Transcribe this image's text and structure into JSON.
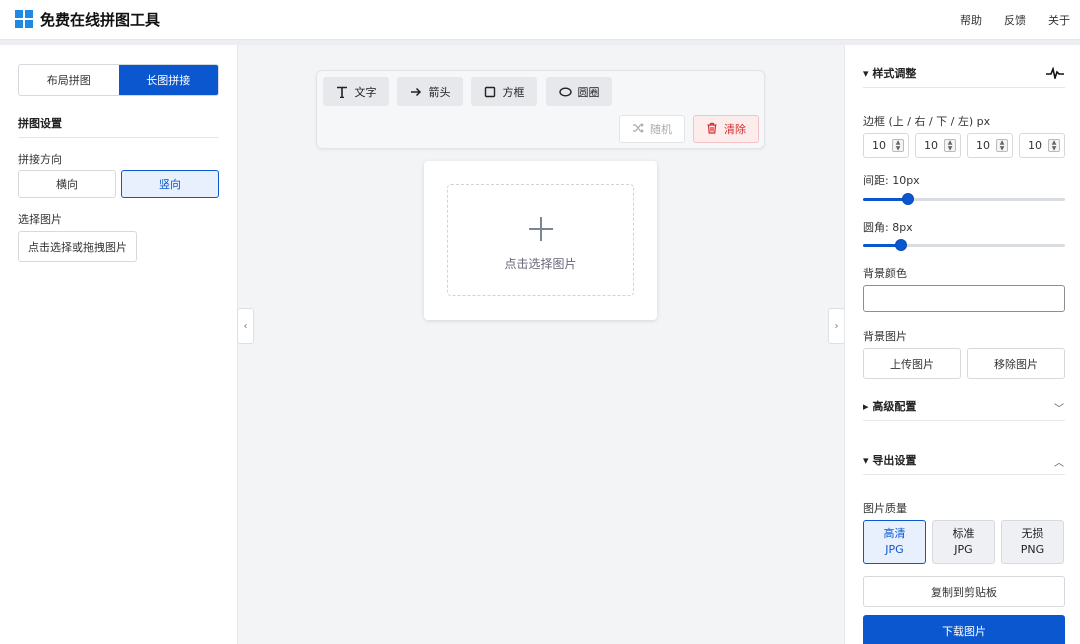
{
  "header": {
    "brand": "免费在线拼图工具",
    "nav": [
      "帮助",
      "反馈",
      "关于"
    ]
  },
  "left": {
    "tabs": [
      "布局拼图",
      "长图拼接"
    ],
    "active_tab": 1,
    "section_title": "拼图设置",
    "direction_label": "拼接方向",
    "directions": [
      "横向",
      "竖向"
    ],
    "active_direction": 1,
    "pick_label": "选择图片",
    "pick_button": "点击选择或拖拽图片"
  },
  "toolbar": {
    "tools": [
      {
        "label": "文字",
        "icon": "text-icon"
      },
      {
        "label": "箭头",
        "icon": "arrow-right-icon"
      },
      {
        "label": "方框",
        "icon": "square-icon"
      },
      {
        "label": "圆圈",
        "icon": "ellipse-icon"
      }
    ],
    "random": "随机",
    "clear": "清除"
  },
  "canvas": {
    "placeholder": "点击选择图片"
  },
  "right": {
    "style_section": "样式调整",
    "border_label": "边框 (上 / 右 / 下 / 左) px",
    "border_values": [
      "10",
      "10",
      "10",
      "10"
    ],
    "gap_label": "间距: 10px",
    "gap_value": 10,
    "radius_label": "圆角: 8px",
    "radius_value": 8,
    "bg_color_label": "背景颜色",
    "bg_image_label": "背景图片",
    "upload_image": "上传图片",
    "remove_image": "移除图片",
    "advanced_section": "高级配置",
    "export_section": "导出设置",
    "quality_label": "图片质量",
    "quality_options": [
      {
        "line1": "高清",
        "line2": "JPG"
      },
      {
        "line1": "标准",
        "line2": "JPG"
      },
      {
        "line1": "无损",
        "line2": "PNG"
      }
    ],
    "active_quality": 0,
    "copy_button": "复制到剪贴板",
    "download_button": "下载图片"
  },
  "colors": {
    "accent": "#0b57d0",
    "danger": "#d32f2f"
  }
}
